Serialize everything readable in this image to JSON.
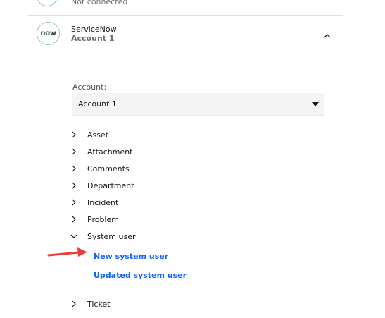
{
  "top_connection": {
    "status": "Not connected"
  },
  "servicenow": {
    "logo_text": "now",
    "title": "ServiceNow",
    "account_subtitle": "Account 1"
  },
  "account": {
    "label": "Account:",
    "selected": "Account 1"
  },
  "tree": {
    "items": [
      {
        "label": "Asset",
        "expanded": false
      },
      {
        "label": "Attachment",
        "expanded": false
      },
      {
        "label": "Comments",
        "expanded": false
      },
      {
        "label": "Department",
        "expanded": false
      },
      {
        "label": "Incident",
        "expanded": false
      },
      {
        "label": "Problem",
        "expanded": false
      },
      {
        "label": "System user",
        "expanded": true
      },
      {
        "label": "Ticket",
        "expanded": false
      }
    ],
    "system_user_children": [
      "New system user",
      "Updated system user"
    ]
  },
  "colors": {
    "link": "#0f62fe",
    "annotation_arrow": "#e5403b",
    "logo_border": "#8fc5c5"
  },
  "icons": {
    "collapse": "chevron-up-icon",
    "select_caret": "caret-down-icon",
    "tree_collapsed": "chevron-right-icon",
    "tree_expanded": "chevron-down-icon"
  }
}
